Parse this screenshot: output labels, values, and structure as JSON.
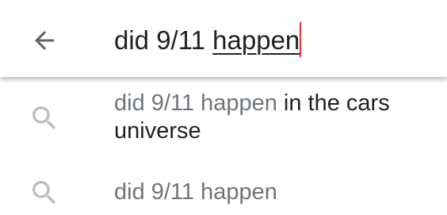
{
  "search": {
    "query_prefix": "did 9/11 ",
    "query_composing": "happen",
    "back_icon": "arrow-back-icon",
    "caret_color": "#e0362d"
  },
  "suggestions": [
    {
      "icon": "search-icon",
      "match": "did 9/11 happen",
      "completion": " in the cars universe"
    },
    {
      "icon": "search-icon",
      "match": "did 9/11 happen",
      "completion": ""
    }
  ],
  "colors": {
    "text": "#202124",
    "muted_text": "#70757a",
    "icon": "#5f6368",
    "suggestion_icon": "#bdbdbd"
  }
}
